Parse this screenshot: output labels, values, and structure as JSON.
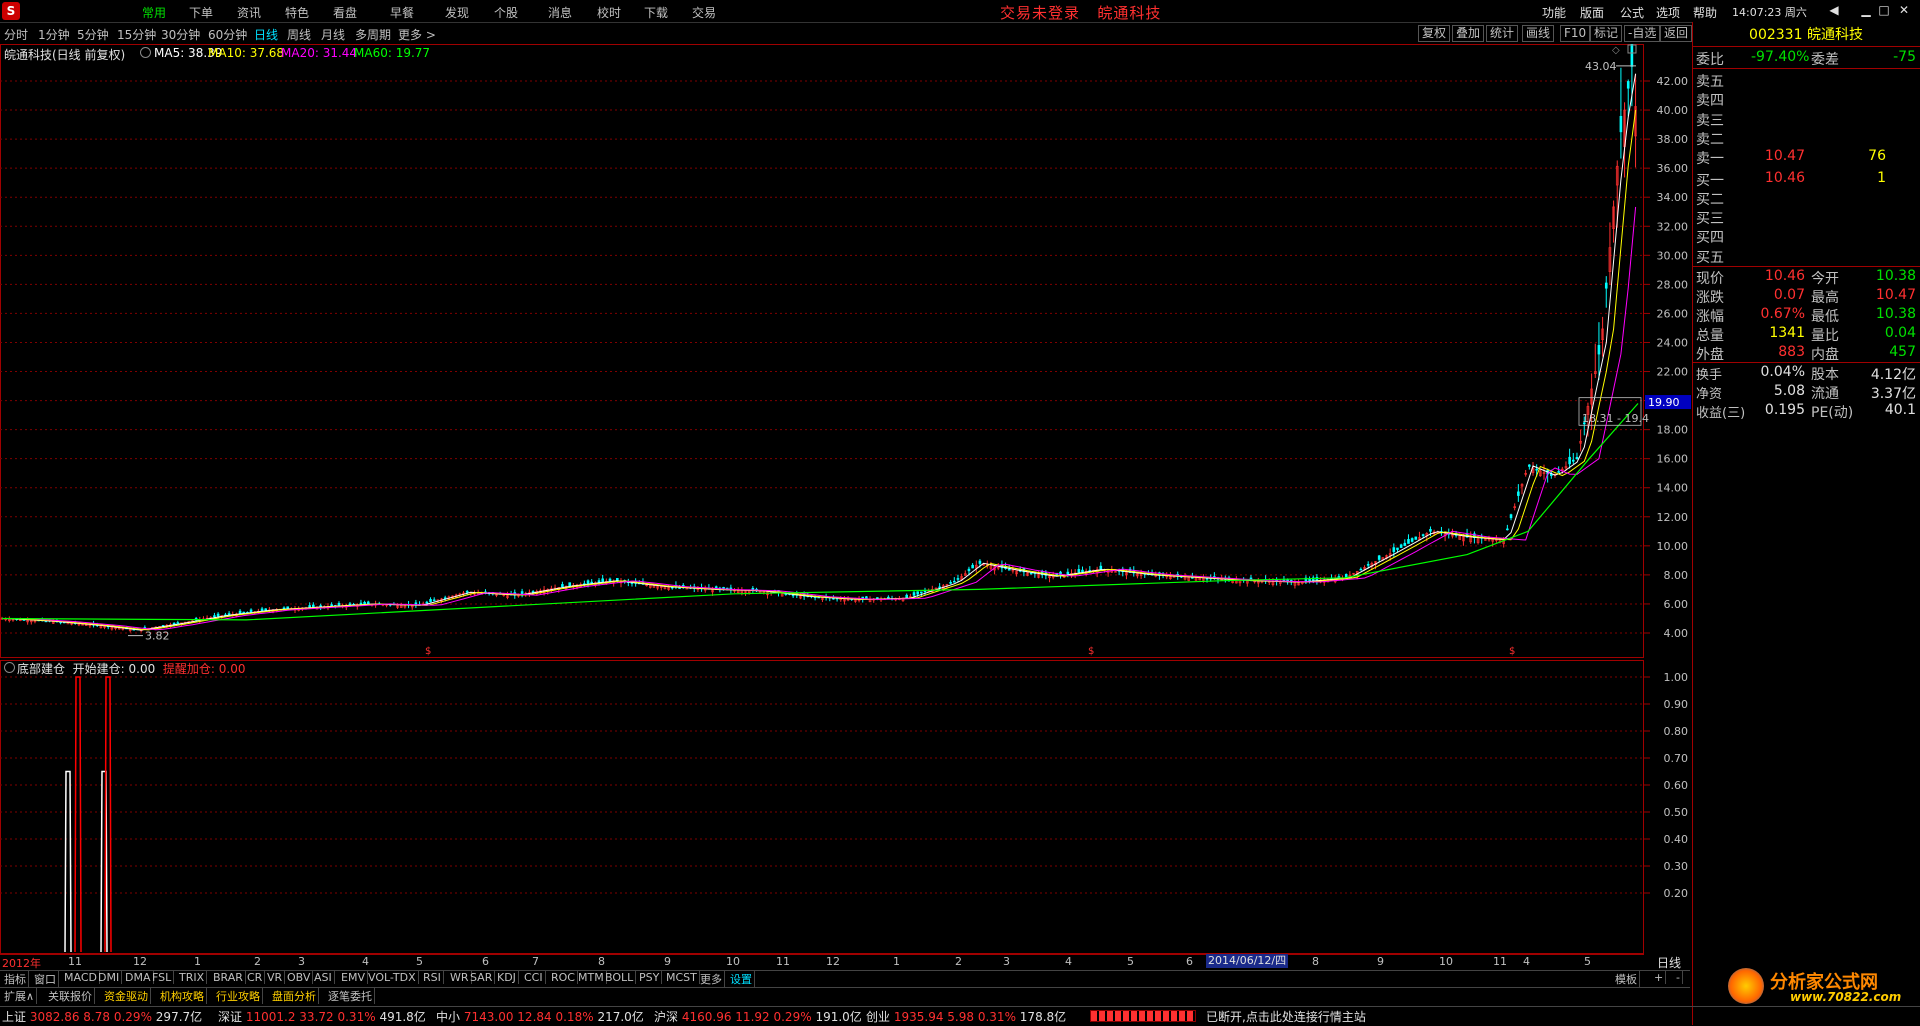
{
  "topbar": {
    "logo": "S",
    "menus": [
      "常用",
      "下单",
      "资讯",
      "特色",
      "看盘",
      "早餐",
      "发现",
      "个股",
      "消息",
      "校时",
      "下载",
      "交易"
    ],
    "center_text": "交易未登录",
    "center_stock": "皖通科技",
    "right_menus": [
      "功能",
      "版面",
      "公式",
      "选项",
      "帮助"
    ],
    "clock": "14:07:23 周六"
  },
  "periods": [
    "分时",
    "1分钟",
    "5分钟",
    "15分钟",
    "30分钟",
    "60分钟",
    "日线",
    "周线",
    "月线",
    "多周期",
    "更多 >"
  ],
  "selected_period": "日线",
  "tools": [
    "复权",
    "叠加",
    "统计",
    "画线",
    "F10",
    "标记",
    "-自选",
    "返回"
  ],
  "legend": {
    "title": "皖通科技(日线 前复权)",
    "ma5": "MA5: 38.39",
    "ma10": "MA10: 37.68",
    "ma20": "MA20: 31.44",
    "ma60": "MA60: 19.77"
  },
  "colors": {
    "ma5": "#ffffff",
    "ma10": "#ffff00",
    "ma20": "#ff00ff",
    "ma60": "#00ff00",
    "up": "#ff3030",
    "down": "#00ffff"
  },
  "price_axis": [
    "42.00",
    "40.00",
    "38.00",
    "36.00",
    "34.00",
    "32.00",
    "30.00",
    "28.00",
    "26.00",
    "24.00",
    "22.00",
    "20.00",
    "18.00",
    "16.00",
    "14.00",
    "12.00",
    "10.00",
    "8.00",
    "6.00",
    "4.00"
  ],
  "price_marker": "19.90",
  "annotations": {
    "high": "43.04",
    "low": "3.82",
    "range": "18.31 - 19.4"
  },
  "indicator": {
    "name": "底部建仓",
    "open_label": "开始建仓:",
    "open_value": "0.00",
    "add_label": "提醒加仓:",
    "add_value": "0.00"
  },
  "ind_axis": [
    "1.00",
    "0.90",
    "0.80",
    "0.70",
    "0.60",
    "0.50",
    "0.40",
    "0.30",
    "0.20"
  ],
  "time_axis": {
    "labels": [
      "2012年",
      "11",
      "12",
      "1",
      "2",
      "3",
      "4",
      "5",
      "6",
      "7",
      "8",
      "9",
      "10",
      "11",
      "12",
      "1",
      "2",
      "3",
      "4",
      "5",
      "6",
      "8",
      "9",
      "10",
      "11",
      "4",
      "5"
    ],
    "highlight": "2014/06/12/四",
    "period": "日线"
  },
  "indicator_tabs": [
    "指标",
    "窗口",
    "MACD",
    "DMI",
    "DMA",
    "FSL",
    "TRIX",
    "BRAR",
    "CR",
    "VR",
    "OBV",
    "ASI",
    "EMV",
    "VOL-TDX",
    "RSI",
    "WR",
    "SAR",
    "KDJ",
    "CCI",
    "ROC",
    "MTM",
    "BOLL",
    "PSY",
    "MCST",
    "更多",
    "设置"
  ],
  "tabs_right": [
    "模板",
    "+",
    "-"
  ],
  "func_tabs": [
    "扩展∧",
    "关联报价",
    "资金驱动",
    "机构攻略",
    "行业攻略",
    "盘面分析",
    "逐笔委托"
  ],
  "quote": {
    "code": "002331",
    "name": "皖通科技",
    "webi_label": "委比",
    "webi": "-97.40%",
    "weicha_label": "委差",
    "weicha": "-75",
    "sells": [
      {
        "label": "卖五",
        "price": "",
        "vol": ""
      },
      {
        "label": "卖四",
        "price": "",
        "vol": ""
      },
      {
        "label": "卖三",
        "price": "",
        "vol": ""
      },
      {
        "label": "卖二",
        "price": "",
        "vol": ""
      },
      {
        "label": "卖一",
        "price": "10.47",
        "vol": "76"
      }
    ],
    "buys": [
      {
        "label": "买一",
        "price": "10.46",
        "vol": "1"
      },
      {
        "label": "买二",
        "price": "",
        "vol": ""
      },
      {
        "label": "买三",
        "price": "",
        "vol": ""
      },
      {
        "label": "买四",
        "price": "",
        "vol": ""
      },
      {
        "label": "买五",
        "price": "",
        "vol": ""
      }
    ],
    "stats": [
      {
        "l1": "现价",
        "v1": "10.46",
        "c1": "red",
        "l2": "今开",
        "v2": "10.38",
        "c2": "grn"
      },
      {
        "l1": "涨跌",
        "v1": "0.07",
        "c1": "red",
        "l2": "最高",
        "v2": "10.47",
        "c2": "red"
      },
      {
        "l1": "涨幅",
        "v1": "0.67%",
        "c1": "red",
        "l2": "最低",
        "v2": "10.38",
        "c2": "grn"
      },
      {
        "l1": "总量",
        "v1": "1341",
        "c1": "yel",
        "l2": "量比",
        "v2": "0.04",
        "c2": "grn"
      },
      {
        "l1": "外盘",
        "v1": "883",
        "c1": "red",
        "l2": "内盘",
        "v2": "457",
        "c2": "grn"
      }
    ],
    "stats2": [
      {
        "l1": "换手",
        "v1": "0.04%",
        "l2": "股本",
        "v2": "4.12亿"
      },
      {
        "l1": "净资",
        "v1": "5.08",
        "l2": "流通",
        "v2": "3.37亿"
      },
      {
        "l1": "收益(三)",
        "v1": "0.195",
        "l2": "PE(动)",
        "v2": "40.1"
      }
    ]
  },
  "status": {
    "sh_label": "上证",
    "sh": "3082.86",
    "sh_chg": "8.78",
    "sh_pct": "0.29%",
    "sh_amt": "297.7亿",
    "sz_label": "深证",
    "sz": "11001.2",
    "sz_chg": "33.72",
    "sz_pct": "0.31%",
    "sz_amt": "491.8亿",
    "zx_label": "中小",
    "zx": "7143.00",
    "zx_chg": "12.84",
    "zx_pct": "0.18%",
    "zx_amt": "217.0亿",
    "hs_label": "沪深",
    "hs": "4160.96",
    "hs_chg": "11.92",
    "hs_pct": "0.29%",
    "hs_amt": "191.0亿",
    "cy_label": "创业",
    "cy": "1935.94",
    "cy_chg": "5.98",
    "cy_pct": "0.31%",
    "cy_amt": "178.8亿",
    "msg": "已断开,点击此处连接行情主站"
  },
  "watermark": {
    "text": "分析家公式网",
    "url": "www.70822.com"
  },
  "chart_data": {
    "type": "candlestick",
    "title": "皖通科技(日线 前复权)",
    "ylim": [
      3,
      44
    ],
    "close_path_points": [
      [
        0,
        5.0
      ],
      [
        40,
        4.8
      ],
      [
        80,
        4.5
      ],
      [
        110,
        4.2
      ],
      [
        140,
        4.6
      ],
      [
        180,
        5.2
      ],
      [
        220,
        5.6
      ],
      [
        260,
        5.8
      ],
      [
        300,
        6.0
      ],
      [
        340,
        5.9
      ],
      [
        380,
        6.8
      ],
      [
        420,
        6.6
      ],
      [
        460,
        7.2
      ],
      [
        500,
        7.6
      ],
      [
        540,
        7.2
      ],
      [
        580,
        7.0
      ],
      [
        620,
        6.9
      ],
      [
        660,
        6.5
      ],
      [
        700,
        6.3
      ],
      [
        740,
        6.4
      ],
      [
        780,
        7.5
      ],
      [
        800,
        8.8
      ],
      [
        830,
        8.3
      ],
      [
        860,
        7.9
      ],
      [
        900,
        8.4
      ],
      [
        940,
        8.0
      ],
      [
        980,
        7.8
      ],
      [
        1020,
        7.6
      ],
      [
        1060,
        7.5
      ],
      [
        1100,
        7.8
      ],
      [
        1140,
        9.6
      ],
      [
        1170,
        11.0
      ],
      [
        1200,
        10.6
      ],
      [
        1230,
        10.4
      ],
      [
        1250,
        15.5
      ],
      [
        1270,
        14.8
      ],
      [
        1290,
        16.0
      ],
      [
        1310,
        24.0
      ],
      [
        1325,
        38.0
      ],
      [
        1335,
        43.0
      ],
      [
        1340,
        38.4
      ]
    ],
    "ma60_points": [
      [
        0,
        5.0
      ],
      [
        200,
        4.9
      ],
      [
        400,
        5.8
      ],
      [
        600,
        6.7
      ],
      [
        800,
        7.0
      ],
      [
        1000,
        7.6
      ],
      [
        1100,
        7.8
      ],
      [
        1200,
        9.4
      ],
      [
        1250,
        11.0
      ],
      [
        1300,
        16.0
      ],
      [
        1340,
        19.8
      ]
    ],
    "indicator_spikes": [
      {
        "x": 68,
        "value": 0.65,
        "color": "#ffffff"
      },
      {
        "x": 78,
        "value": 1.0,
        "color": "#ff0000"
      },
      {
        "x": 104,
        "value": 0.65,
        "color": "#ffffff"
      },
      {
        "x": 108,
        "value": 1.0,
        "color": "#ff0000"
      }
    ]
  }
}
